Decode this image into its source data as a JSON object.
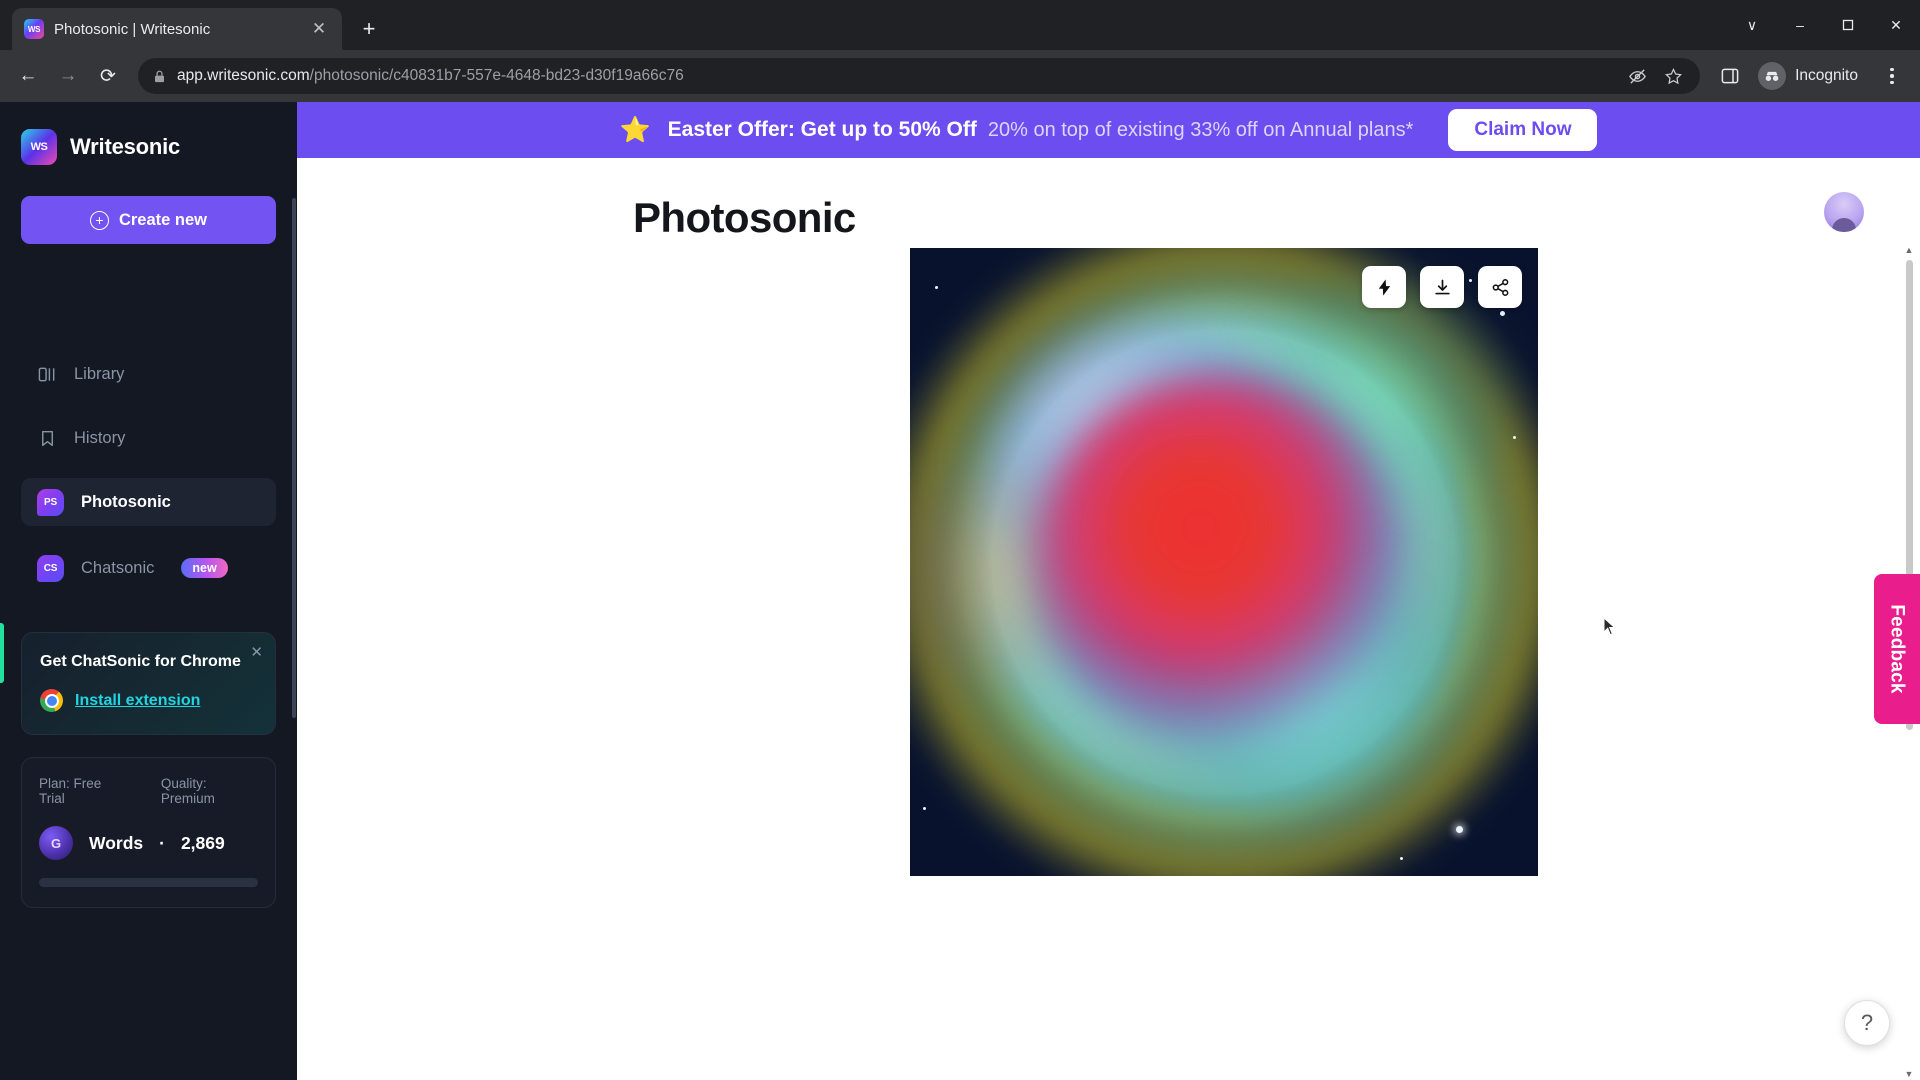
{
  "browser": {
    "tab": {
      "title": "Photosonic | Writesonic",
      "favicon_label": "WS",
      "close_icon": "close-icon"
    },
    "newtab_label": "+",
    "window_controls": {
      "minimize": "–",
      "maximize": "❑",
      "close": "✕",
      "chevron": "∨"
    },
    "nav": {
      "back": "←",
      "forward": "→",
      "reload": "⟳"
    },
    "address": {
      "host": "app.writesonic.com",
      "path": "/photosonic/c40831b7-557e-4648-bd23-d30f19a66c76",
      "lock_icon": "lock-icon",
      "tracking_icon": "eye-crossed-icon",
      "bookmark_icon": "star-icon",
      "sidepanel_icon": "side-panel-icon"
    },
    "profile": {
      "label": "Incognito",
      "icon": "incognito-icon"
    },
    "menu_icon": "kebab-menu-icon"
  },
  "sidebar": {
    "brand": {
      "name": "Writesonic",
      "mark": "WS"
    },
    "create_button": {
      "label": "Create new",
      "icon": "plus-circle-icon"
    },
    "nav_items": [
      {
        "label": "Library",
        "icon": "panels-icon",
        "active": false
      },
      {
        "label": "History",
        "icon": "bookmark-icon",
        "active": false
      }
    ],
    "apps": [
      {
        "label": "Photosonic",
        "mark": "PS",
        "active": true,
        "badge": ""
      },
      {
        "label": "Chatsonic",
        "mark": "CS",
        "active": false,
        "badge": "new"
      }
    ],
    "promo": {
      "title": "Get ChatSonic for Chrome",
      "link": "Install extension",
      "close_icon": "close-icon",
      "chrome_icon": "chrome-logo-icon"
    },
    "plan": {
      "plan_text": "Plan: Free Trial",
      "quality_text": "Quality: Premium",
      "words_label": "Words",
      "separator": "·",
      "words_value": "2,869",
      "avatar_initial": "G"
    }
  },
  "banner": {
    "star_icon": "star-icon",
    "headline": "Easter Offer: Get up to 50% Off",
    "subtext": "20% on top of existing 33% off on Annual plans*",
    "cta_label": "Claim Now"
  },
  "main": {
    "page_title": "Photosonic",
    "avatar_name": "user-avatar",
    "image_toolbar": [
      {
        "name": "enhance-button",
        "icon": "lightning-bolt-icon"
      },
      {
        "name": "download-button",
        "icon": "download-icon"
      },
      {
        "name": "share-button",
        "icon": "share-icon"
      }
    ],
    "feedback_tab": "Feedback",
    "help_button": "?"
  }
}
